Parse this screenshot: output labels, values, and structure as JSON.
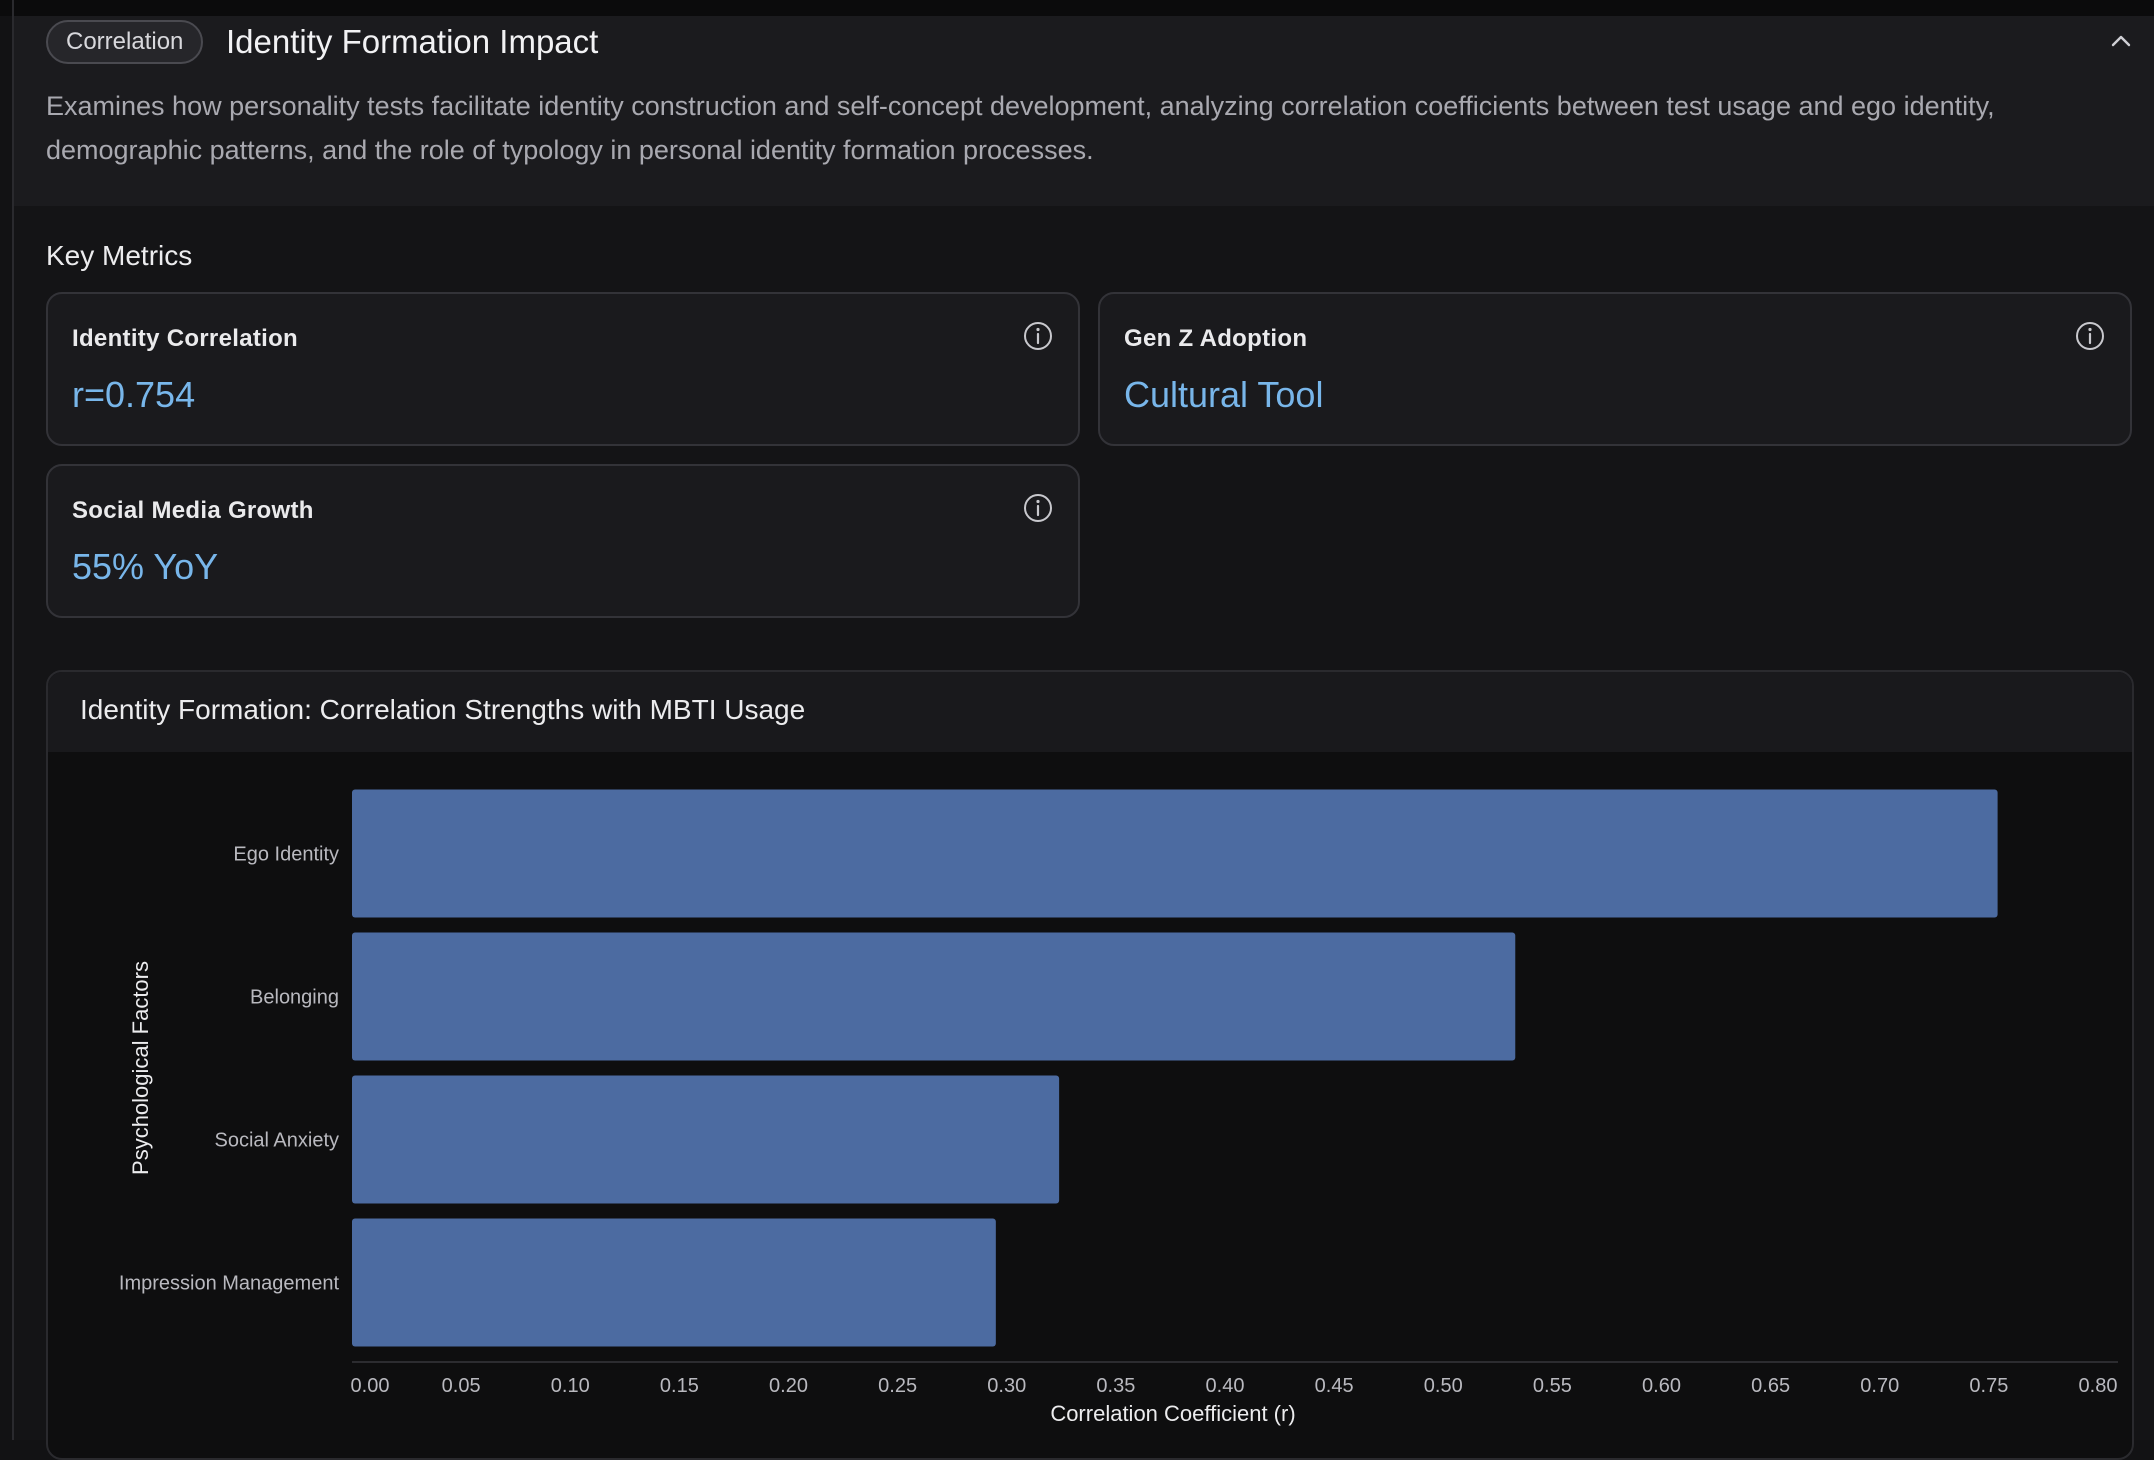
{
  "header": {
    "badge": "Correlation",
    "title": "Identity Formation Impact",
    "description": "Examines how personality tests facilitate identity construction and self-concept development, analyzing correlation coefficients between test usage and ego identity, demographic patterns, and the role of typology in personal identity formation processes."
  },
  "key_metrics": {
    "label": "Key Metrics",
    "cards": [
      {
        "label": "Identity Correlation",
        "value": "r=0.754"
      },
      {
        "label": "Gen Z Adoption",
        "value": "Cultural Tool"
      },
      {
        "label": "Social Media Growth",
        "value": "55% YoY"
      }
    ]
  },
  "chart_data": {
    "type": "bar",
    "orientation": "horizontal",
    "title": "Identity Formation: Correlation Strengths with MBTI Usage",
    "xlabel": "Correlation Coefficient (r)",
    "ylabel": "Psychological Factors",
    "categories": [
      "Ego Identity",
      "Belonging",
      "Social Anxiety",
      "Impression Management"
    ],
    "values": [
      0.754,
      0.533,
      0.324,
      0.295
    ],
    "xlim": [
      0,
      0.8
    ],
    "xticks": [
      "0.00",
      "0.05",
      "0.10",
      "0.15",
      "0.20",
      "0.25",
      "0.30",
      "0.35",
      "0.40",
      "0.45",
      "0.50",
      "0.55",
      "0.60",
      "0.65",
      "0.70",
      "0.75",
      "0.80"
    ],
    "bar_color": "#4c6ba1",
    "grid": false
  },
  "colors": {
    "accent": "#78b6ea",
    "background": "#121214",
    "bar": "#4c6ba1"
  },
  "icons": {
    "collapse": "chevron-up-icon",
    "info": "info-icon"
  }
}
